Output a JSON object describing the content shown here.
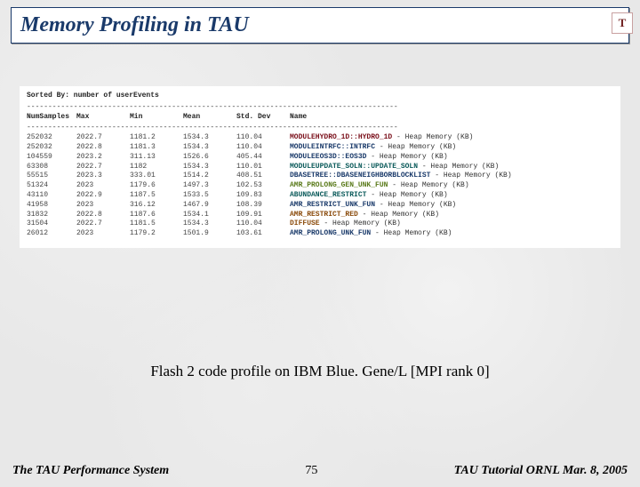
{
  "slide": {
    "title": "Memory Profiling in TAU",
    "badge": "T",
    "caption": "Flash 2 code profile on IBM Blue. Gene/L [MPI rank 0]",
    "footer_left": "The TAU Performance System",
    "footer_center": "75",
    "footer_right": "TAU Tutorial ORNL Mar. 8, 2005"
  },
  "profile": {
    "sorted_by": "Sorted By: number of userEvents",
    "dashes": "---------------------------------------------------------------------------------------",
    "columns": [
      "NumSamples",
      "Max",
      "Min",
      "Mean",
      "Std. Dev",
      "Name"
    ],
    "rows": [
      {
        "num": "252032",
        "max": "2022.7",
        "min": "1181.2",
        "mean": "1534.3",
        "std": "110.04",
        "mod": "MODULEHYDRO_1D::HYDRO_1D",
        "mod_color": "c1",
        "suffix": "  - Heap Memory (KB)"
      },
      {
        "num": "252032",
        "max": "2022.8",
        "min": "1181.3",
        "mean": "1534.3",
        "std": "110.04",
        "mod": "MODULEINTRFC::INTRFC",
        "mod_color": "c2",
        "suffix": "  - Heap Memory (KB)"
      },
      {
        "num": "104559",
        "max": "2023.2",
        "min": "311.13",
        "mean": "1526.6",
        "std": "405.44",
        "mod": "MODULEEOS3D::EOS3D",
        "mod_color": "c2",
        "suffix": "  - Heap Memory (KB)"
      },
      {
        "num": "63308",
        "max": "2022.7",
        "min": "1182",
        "mean": "1534.3",
        "std": "110.01",
        "mod": "MODULEUPDATE_SOLN::UPDATE_SOLN",
        "mod_color": "c5",
        "suffix": "  - Heap Memory (KB)"
      },
      {
        "num": "55515",
        "max": "2023.3",
        "min": "333.01",
        "mean": "1514.2",
        "std": "408.51",
        "mod": "DBASETREE::DBASENEIGHBORBLOCKLIST",
        "mod_color": "c2",
        "suffix": "  - Heap Memory (KB)"
      },
      {
        "num": "51324",
        "max": "2023",
        "min": "1179.6",
        "mean": "1497.3",
        "std": "102.53",
        "mod": "AMR_PROLONG_GEN_UNK_FUN",
        "mod_color": "c3",
        "suffix": "  - Heap Memory (KB)"
      },
      {
        "num": "43110",
        "max": "2022.9",
        "min": "1187.5",
        "mean": "1533.5",
        "std": "109.83",
        "mod": "ABUNDANCE_RESTRICT",
        "mod_color": "c5",
        "suffix": "  - Heap Memory (KB)"
      },
      {
        "num": "41958",
        "max": "2023",
        "min": "316.12",
        "mean": "1467.9",
        "std": "108.39",
        "mod": "AMR_RESTRICT_UNK_FUN",
        "mod_color": "c2",
        "suffix": "  - Heap Memory (KB)"
      },
      {
        "num": "31832",
        "max": "2022.8",
        "min": "1187.6",
        "mean": "1534.1",
        "std": "109.91",
        "mod": "AMR_RESTRICT_RED",
        "mod_color": "c4",
        "suffix": "  - Heap Memory (KB)"
      },
      {
        "num": "31504",
        "max": "2022.7",
        "min": "1181.5",
        "mean": "1534.3",
        "std": "110.04",
        "mod": "DIFFUSE",
        "mod_color": "c4",
        "suffix": "  - Heap Memory (KB)"
      },
      {
        "num": "26012",
        "max": "2023",
        "min": "1179.2",
        "mean": "1501.9",
        "std": "103.61",
        "mod": "AMR_PROLONG_UNK_FUN",
        "mod_color": "c2",
        "suffix": "  - Heap Memory (KB)"
      }
    ]
  }
}
